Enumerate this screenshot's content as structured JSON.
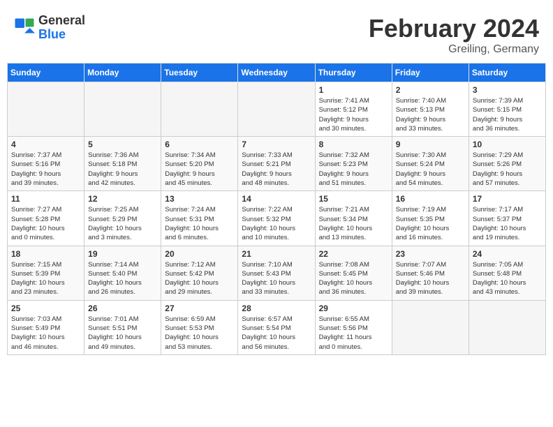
{
  "header": {
    "logo_general": "General",
    "logo_blue": "Blue",
    "month_title": "February 2024",
    "location": "Greiling, Germany"
  },
  "weekdays": [
    "Sunday",
    "Monday",
    "Tuesday",
    "Wednesday",
    "Thursday",
    "Friday",
    "Saturday"
  ],
  "weeks": [
    [
      {
        "day": "",
        "info": ""
      },
      {
        "day": "",
        "info": ""
      },
      {
        "day": "",
        "info": ""
      },
      {
        "day": "",
        "info": ""
      },
      {
        "day": "1",
        "info": "Sunrise: 7:41 AM\nSunset: 5:12 PM\nDaylight: 9 hours\nand 30 minutes."
      },
      {
        "day": "2",
        "info": "Sunrise: 7:40 AM\nSunset: 5:13 PM\nDaylight: 9 hours\nand 33 minutes."
      },
      {
        "day": "3",
        "info": "Sunrise: 7:39 AM\nSunset: 5:15 PM\nDaylight: 9 hours\nand 36 minutes."
      }
    ],
    [
      {
        "day": "4",
        "info": "Sunrise: 7:37 AM\nSunset: 5:16 PM\nDaylight: 9 hours\nand 39 minutes."
      },
      {
        "day": "5",
        "info": "Sunrise: 7:36 AM\nSunset: 5:18 PM\nDaylight: 9 hours\nand 42 minutes."
      },
      {
        "day": "6",
        "info": "Sunrise: 7:34 AM\nSunset: 5:20 PM\nDaylight: 9 hours\nand 45 minutes."
      },
      {
        "day": "7",
        "info": "Sunrise: 7:33 AM\nSunset: 5:21 PM\nDaylight: 9 hours\nand 48 minutes."
      },
      {
        "day": "8",
        "info": "Sunrise: 7:32 AM\nSunset: 5:23 PM\nDaylight: 9 hours\nand 51 minutes."
      },
      {
        "day": "9",
        "info": "Sunrise: 7:30 AM\nSunset: 5:24 PM\nDaylight: 9 hours\nand 54 minutes."
      },
      {
        "day": "10",
        "info": "Sunrise: 7:29 AM\nSunset: 5:26 PM\nDaylight: 9 hours\nand 57 minutes."
      }
    ],
    [
      {
        "day": "11",
        "info": "Sunrise: 7:27 AM\nSunset: 5:28 PM\nDaylight: 10 hours\nand 0 minutes."
      },
      {
        "day": "12",
        "info": "Sunrise: 7:25 AM\nSunset: 5:29 PM\nDaylight: 10 hours\nand 3 minutes."
      },
      {
        "day": "13",
        "info": "Sunrise: 7:24 AM\nSunset: 5:31 PM\nDaylight: 10 hours\nand 6 minutes."
      },
      {
        "day": "14",
        "info": "Sunrise: 7:22 AM\nSunset: 5:32 PM\nDaylight: 10 hours\nand 10 minutes."
      },
      {
        "day": "15",
        "info": "Sunrise: 7:21 AM\nSunset: 5:34 PM\nDaylight: 10 hours\nand 13 minutes."
      },
      {
        "day": "16",
        "info": "Sunrise: 7:19 AM\nSunset: 5:35 PM\nDaylight: 10 hours\nand 16 minutes."
      },
      {
        "day": "17",
        "info": "Sunrise: 7:17 AM\nSunset: 5:37 PM\nDaylight: 10 hours\nand 19 minutes."
      }
    ],
    [
      {
        "day": "18",
        "info": "Sunrise: 7:15 AM\nSunset: 5:39 PM\nDaylight: 10 hours\nand 23 minutes."
      },
      {
        "day": "19",
        "info": "Sunrise: 7:14 AM\nSunset: 5:40 PM\nDaylight: 10 hours\nand 26 minutes."
      },
      {
        "day": "20",
        "info": "Sunrise: 7:12 AM\nSunset: 5:42 PM\nDaylight: 10 hours\nand 29 minutes."
      },
      {
        "day": "21",
        "info": "Sunrise: 7:10 AM\nSunset: 5:43 PM\nDaylight: 10 hours\nand 33 minutes."
      },
      {
        "day": "22",
        "info": "Sunrise: 7:08 AM\nSunset: 5:45 PM\nDaylight: 10 hours\nand 36 minutes."
      },
      {
        "day": "23",
        "info": "Sunrise: 7:07 AM\nSunset: 5:46 PM\nDaylight: 10 hours\nand 39 minutes."
      },
      {
        "day": "24",
        "info": "Sunrise: 7:05 AM\nSunset: 5:48 PM\nDaylight: 10 hours\nand 43 minutes."
      }
    ],
    [
      {
        "day": "25",
        "info": "Sunrise: 7:03 AM\nSunset: 5:49 PM\nDaylight: 10 hours\nand 46 minutes."
      },
      {
        "day": "26",
        "info": "Sunrise: 7:01 AM\nSunset: 5:51 PM\nDaylight: 10 hours\nand 49 minutes."
      },
      {
        "day": "27",
        "info": "Sunrise: 6:59 AM\nSunset: 5:53 PM\nDaylight: 10 hours\nand 53 minutes."
      },
      {
        "day": "28",
        "info": "Sunrise: 6:57 AM\nSunset: 5:54 PM\nDaylight: 10 hours\nand 56 minutes."
      },
      {
        "day": "29",
        "info": "Sunrise: 6:55 AM\nSunset: 5:56 PM\nDaylight: 11 hours\nand 0 minutes."
      },
      {
        "day": "",
        "info": ""
      },
      {
        "day": "",
        "info": ""
      }
    ]
  ]
}
